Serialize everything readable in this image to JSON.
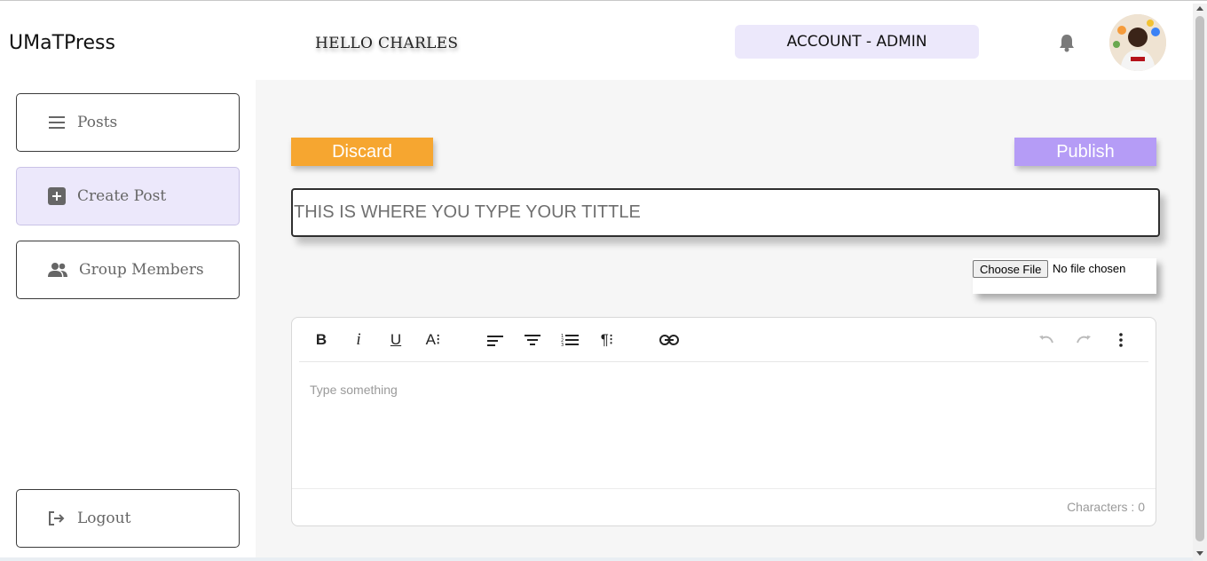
{
  "header": {
    "logo": "UMaTPress",
    "greeting": "HELLO CHARLES",
    "account_label": "ACCOUNT - ADMIN",
    "notification_icon": "bell-icon",
    "avatar_icon": "user-avatar"
  },
  "sidebar": {
    "items": [
      {
        "label": "Posts",
        "icon": "menu-icon",
        "active": false
      },
      {
        "label": "Create Post",
        "icon": "plus-square-icon",
        "active": true
      },
      {
        "label": "Group Members",
        "icon": "users-icon",
        "active": false
      }
    ],
    "logout": {
      "label": "Logout",
      "icon": "logout-icon"
    }
  },
  "main": {
    "discard_label": "Discard",
    "publish_label": "Publish",
    "title_placeholder": "THIS IS WHERE YOU TYPE YOUR TITTLE",
    "file": {
      "button_label": "Choose File",
      "status": "No file chosen"
    },
    "editor": {
      "toolbar": {
        "bold": "B",
        "italic": "i",
        "underline": "U",
        "font_size": "A⁝",
        "paragraph": "¶⁝"
      },
      "placeholder": "Type something",
      "char_count": "Characters : 0"
    }
  },
  "colors": {
    "discard": "#f6a630",
    "publish": "#b59cf6",
    "active_bg": "#ece8fb",
    "main_bg": "#f6f6f6"
  }
}
